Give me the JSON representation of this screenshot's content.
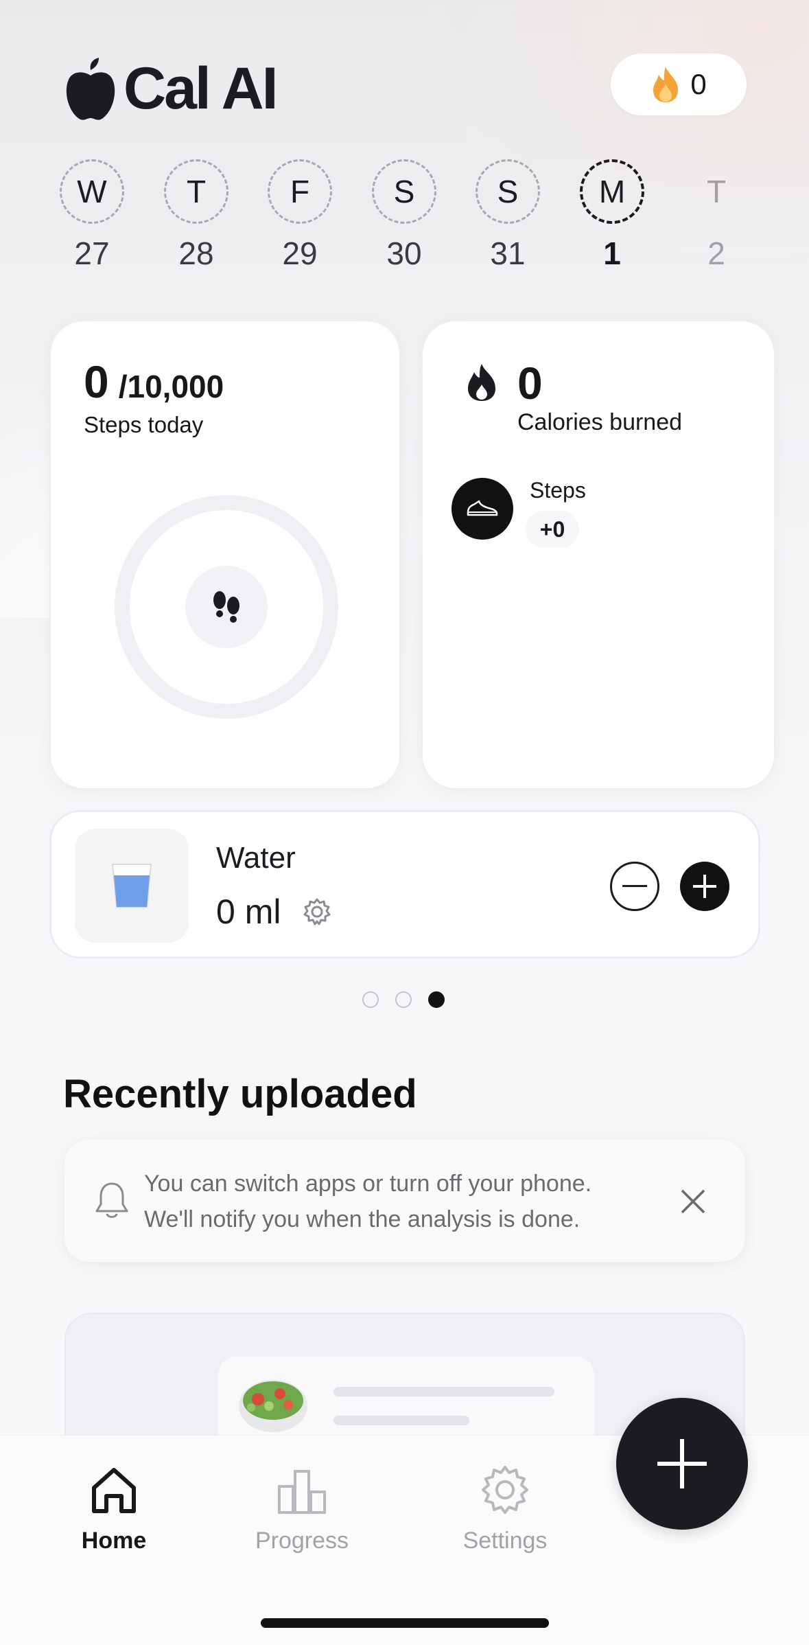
{
  "app": {
    "name": "Cal AI"
  },
  "header": {
    "streak_count": "0"
  },
  "week": [
    {
      "letter": "W",
      "date": "27",
      "state": "past"
    },
    {
      "letter": "T",
      "date": "28",
      "state": "past"
    },
    {
      "letter": "F",
      "date": "29",
      "state": "past"
    },
    {
      "letter": "S",
      "date": "30",
      "state": "past"
    },
    {
      "letter": "S",
      "date": "31",
      "state": "past"
    },
    {
      "letter": "M",
      "date": "1",
      "state": "active"
    },
    {
      "letter": "T",
      "date": "2",
      "state": "future"
    }
  ],
  "steps_card": {
    "value": "0",
    "goal": "/10,000",
    "label": "Steps today",
    "progress": 0
  },
  "calories_card": {
    "value": "0",
    "label": "Calories burned",
    "steps_label": "Steps",
    "steps_delta": "+0"
  },
  "water_card": {
    "title": "Water",
    "amount": "0 ml"
  },
  "pager": {
    "count": 3,
    "active_index": 2
  },
  "recent": {
    "title": "Recently uploaded",
    "notice_line1": "You can switch apps or turn off your phone.",
    "notice_line2": "We'll notify you when the analysis is done."
  },
  "tabbar": {
    "tabs": [
      {
        "label": "Home",
        "icon": "home-icon",
        "active": true
      },
      {
        "label": "Progress",
        "icon": "bar-chart-icon",
        "active": false
      },
      {
        "label": "Settings",
        "icon": "gear-icon",
        "active": false
      }
    ]
  },
  "colors": {
    "accent": "#1c1b22",
    "water": "#6f9fe6",
    "flame": "#f5a23a"
  }
}
